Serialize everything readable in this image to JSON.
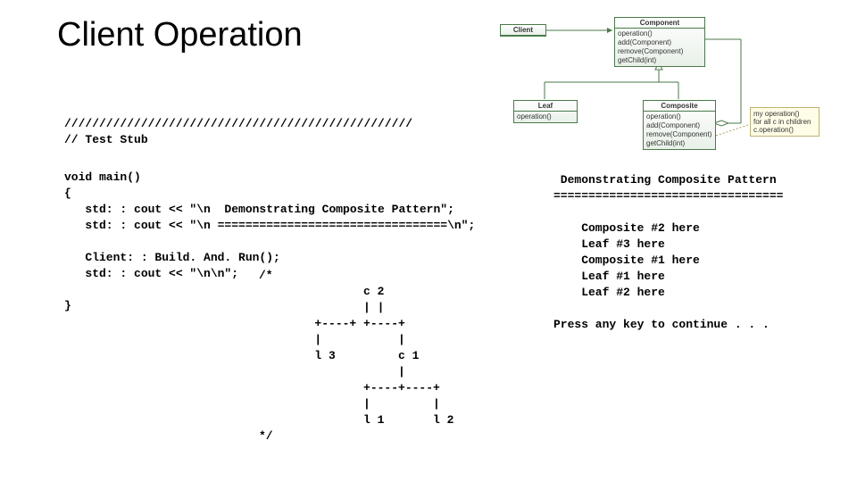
{
  "title": "Client Operation",
  "code": {
    "stub": "//////////////////////////////////////////////////\n// Test Stub",
    "main": "void main()\n{\n   std: : cout << \"\\n  Demonstrating Composite Pattern\";\n   std: : cout << \"\\n =================================\\n\";\n\n   Client: : Build. And. Run();\n   std: : cout << \"\\n\\n\";\n\n}",
    "tree": "/*\n               c 2\n               | |\n        +----+ +----+\n        |           |\n        l 3         c 1\n                    |\n               +----+----+\n               |         |\n               l 1       l 2\n*/"
  },
  "output": " Demonstrating Composite Pattern\n=================================\n\n    Composite #2 here\n    Leaf #3 here\n    Composite #1 here\n    Leaf #1 here\n    Leaf #2 here\n\nPress any key to continue . . .",
  "uml": {
    "client": "Client",
    "component": {
      "name": "Component",
      "methods": "operation()\nadd(Component)\nremove(Component)\ngetChild(int)"
    },
    "leaf": {
      "name": "Leaf",
      "methods": "operation()"
    },
    "composite": {
      "name": "Composite",
      "methods": "operation()\nadd(Component)\nremove(Component)\ngetChild(int)"
    },
    "note": "my operation()\nfor all c in children\nc.operation()"
  }
}
